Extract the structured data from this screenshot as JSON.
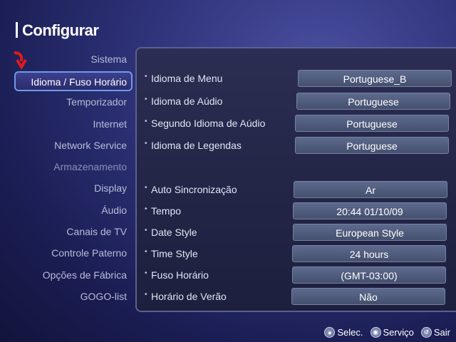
{
  "header": {
    "title": "Configurar"
  },
  "sidebar": {
    "items": [
      {
        "label": "Sistema",
        "selected": false
      },
      {
        "label": "Idioma / Fuso Horário",
        "selected": true
      },
      {
        "label": "Temporizador",
        "selected": false
      },
      {
        "label": "Internet",
        "selected": false
      },
      {
        "label": "Network Service",
        "selected": false
      },
      {
        "label": "Armazenamento",
        "selected": false
      },
      {
        "label": "Display",
        "selected": false
      },
      {
        "label": "Áudio",
        "selected": false
      },
      {
        "label": "Canais de TV",
        "selected": false
      },
      {
        "label": "Controle Paterno",
        "selected": false
      },
      {
        "label": "Opções de Fábrica",
        "selected": false
      },
      {
        "label": "GOGO-list",
        "selected": false
      }
    ]
  },
  "settings": {
    "language": [
      {
        "label": "Idioma de Menu",
        "value": "Portuguese_B"
      },
      {
        "label": "Idioma de Aúdio",
        "value": "Portuguese"
      },
      {
        "label": "Segundo Idioma de Aúdio",
        "value": "Portuguese"
      },
      {
        "label": "Idioma de Legendas",
        "value": "Portuguese"
      }
    ],
    "time": [
      {
        "label": "Auto Sincronização",
        "value": "Ar"
      },
      {
        "label": "Tempo",
        "value": "20:44  01/10/09"
      },
      {
        "label": "Date Style",
        "value": "European Style"
      },
      {
        "label": "Time Style",
        "value": "24 hours"
      },
      {
        "label": "Fuso Horário",
        "value": "(GMT-03:00)"
      },
      {
        "label": "Horário de Verão",
        "value": "Não"
      }
    ]
  },
  "footer": {
    "hints": [
      {
        "icon": "select-button-icon",
        "label": "Selec."
      },
      {
        "icon": "service-button-icon",
        "label": "Serviço"
      },
      {
        "icon": "exit-button-icon",
        "label": "Sair"
      }
    ]
  },
  "colors": {
    "selection_border": "#6f9be8",
    "value_box": "#5d6a8d",
    "background": "#2e3278"
  }
}
